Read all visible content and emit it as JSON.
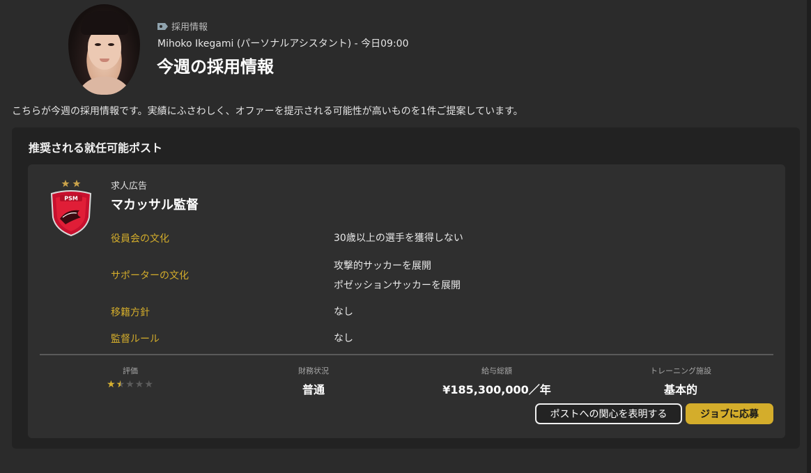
{
  "header": {
    "category": "採用情報",
    "category_icon": "tag-icon",
    "sender": "Mihoko Ikegami (パーソナルアシスタント) - 今日09:00",
    "title": "今週の採用情報"
  },
  "intro": "こちらが今週の採用情報です。実績にふさわしく、オファーを提示される可能性が高いものを1件ご提案しています。",
  "panel": {
    "title": "推奨される就任可能ポスト",
    "card": {
      "label": "求人広告",
      "title": "マカッサル監督",
      "crest_icon": "psm-club-crest",
      "crest_stars": 2,
      "rows": [
        {
          "label": "役員会の文化",
          "values": [
            "30歳以上の選手を獲得しない"
          ]
        },
        {
          "label": "サポーターの文化",
          "values": [
            "攻撃的サッカーを展開",
            "ポゼッションサッカーを展開"
          ]
        },
        {
          "label": "移籍方針",
          "values": [
            "なし"
          ]
        },
        {
          "label": "監督ルール",
          "values": [
            "なし"
          ]
        }
      ],
      "stats": {
        "rating": {
          "label": "評価",
          "stars_filled": 1.5,
          "stars_total": 5
        },
        "finance": {
          "label": "財務状況",
          "value": "普通"
        },
        "wage": {
          "label": "給与総額",
          "value": "¥185,300,000／年"
        },
        "training": {
          "label": "トレーニング施設",
          "value": "基本的"
        }
      },
      "buttons": {
        "interest": "ポストへの関心を表明する",
        "apply": "ジョブに応募"
      }
    }
  },
  "colors": {
    "accent": "#d4ad2b",
    "background": "#2b2b2b",
    "panel": "#222222",
    "card": "#2f2f2f"
  }
}
